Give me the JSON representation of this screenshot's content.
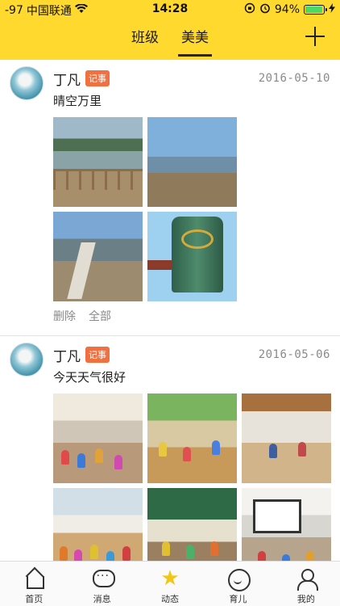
{
  "status_bar": {
    "signal": "-97",
    "carrier": "中国联通",
    "time": "14:28",
    "battery_percent": "94%",
    "battery_level": 0.94
  },
  "header": {
    "tabs": [
      {
        "label": "班级",
        "active": false
      },
      {
        "label": "美美",
        "active": true
      }
    ],
    "add_icon": "plus-icon"
  },
  "feed": {
    "posts": [
      {
        "author": "丁凡",
        "badge": "记事",
        "date": "2016-05-10",
        "text": "晴空万里",
        "photos": [
          "lakeside-boardwalk",
          "lake-shore",
          "dam-slope",
          "bronze-bell"
        ],
        "actions": {
          "delete": "删除",
          "all": "全部"
        }
      },
      {
        "author": "丁凡",
        "badge": "记事",
        "date": "2016-05-06",
        "text": "今天天气很好",
        "photos": [
          "classroom-dance",
          "classroom-play",
          "classroom-reading",
          "classroom-group",
          "classroom-blackboard",
          "classroom-screen"
        ]
      }
    ]
  },
  "bottom_nav": [
    {
      "label": "首页",
      "icon": "home-icon"
    },
    {
      "label": "消息",
      "icon": "message-icon"
    },
    {
      "label": "动态",
      "icon": "star-icon",
      "active": true
    },
    {
      "label": "育儿",
      "icon": "smile-icon"
    },
    {
      "label": "我的",
      "icon": "user-icon"
    }
  ],
  "colors": {
    "header_bg": "#ffd92e",
    "badge_bg": "#f07040",
    "active_star": "#f3c614"
  }
}
